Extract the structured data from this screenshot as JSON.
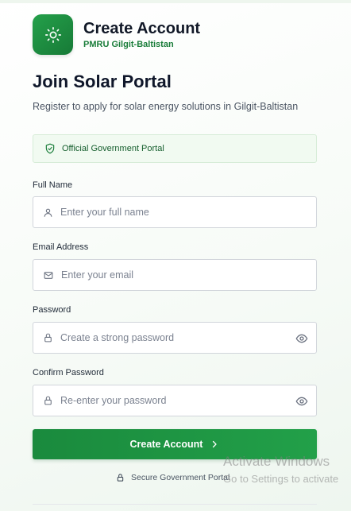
{
  "header": {
    "title": "Create Account",
    "subtitle": "PMRU Gilgit-Baltistan",
    "logo_icon": "sun-icon"
  },
  "main": {
    "heading": "Join Solar Portal",
    "description": "Register to apply for solar energy solutions in Gilgit-Baltistan",
    "notice": {
      "icon": "shield-check-icon",
      "text": "Official Government Portal"
    }
  },
  "form": {
    "full_name": {
      "label": "Full Name",
      "placeholder": "Enter your full name",
      "value": "",
      "icon": "user-icon"
    },
    "email": {
      "label": "Email Address",
      "placeholder": "Enter your email",
      "value": "",
      "icon": "mail-icon"
    },
    "password": {
      "label": "Password",
      "placeholder": "Create a strong password",
      "value": "",
      "icon": "lock-icon",
      "toggle_icon": "eye-icon"
    },
    "confirm_password": {
      "label": "Confirm Password",
      "placeholder": "Re-enter your password",
      "value": "",
      "icon": "lock-icon",
      "toggle_icon": "eye-icon"
    },
    "submit_label": "Create Account",
    "submit_icon": "chevron-right-icon"
  },
  "footer": {
    "secure_text": "Secure Government Portal",
    "icon": "lock-icon"
  },
  "watermark": {
    "line1": "Activate Windows",
    "line2": "Go to Settings to activate"
  },
  "colors": {
    "primary": "#1a8a3d",
    "primary_light": "#22a049",
    "notice_bg": "#f1faf1",
    "accent_text": "#1a7d3a"
  }
}
